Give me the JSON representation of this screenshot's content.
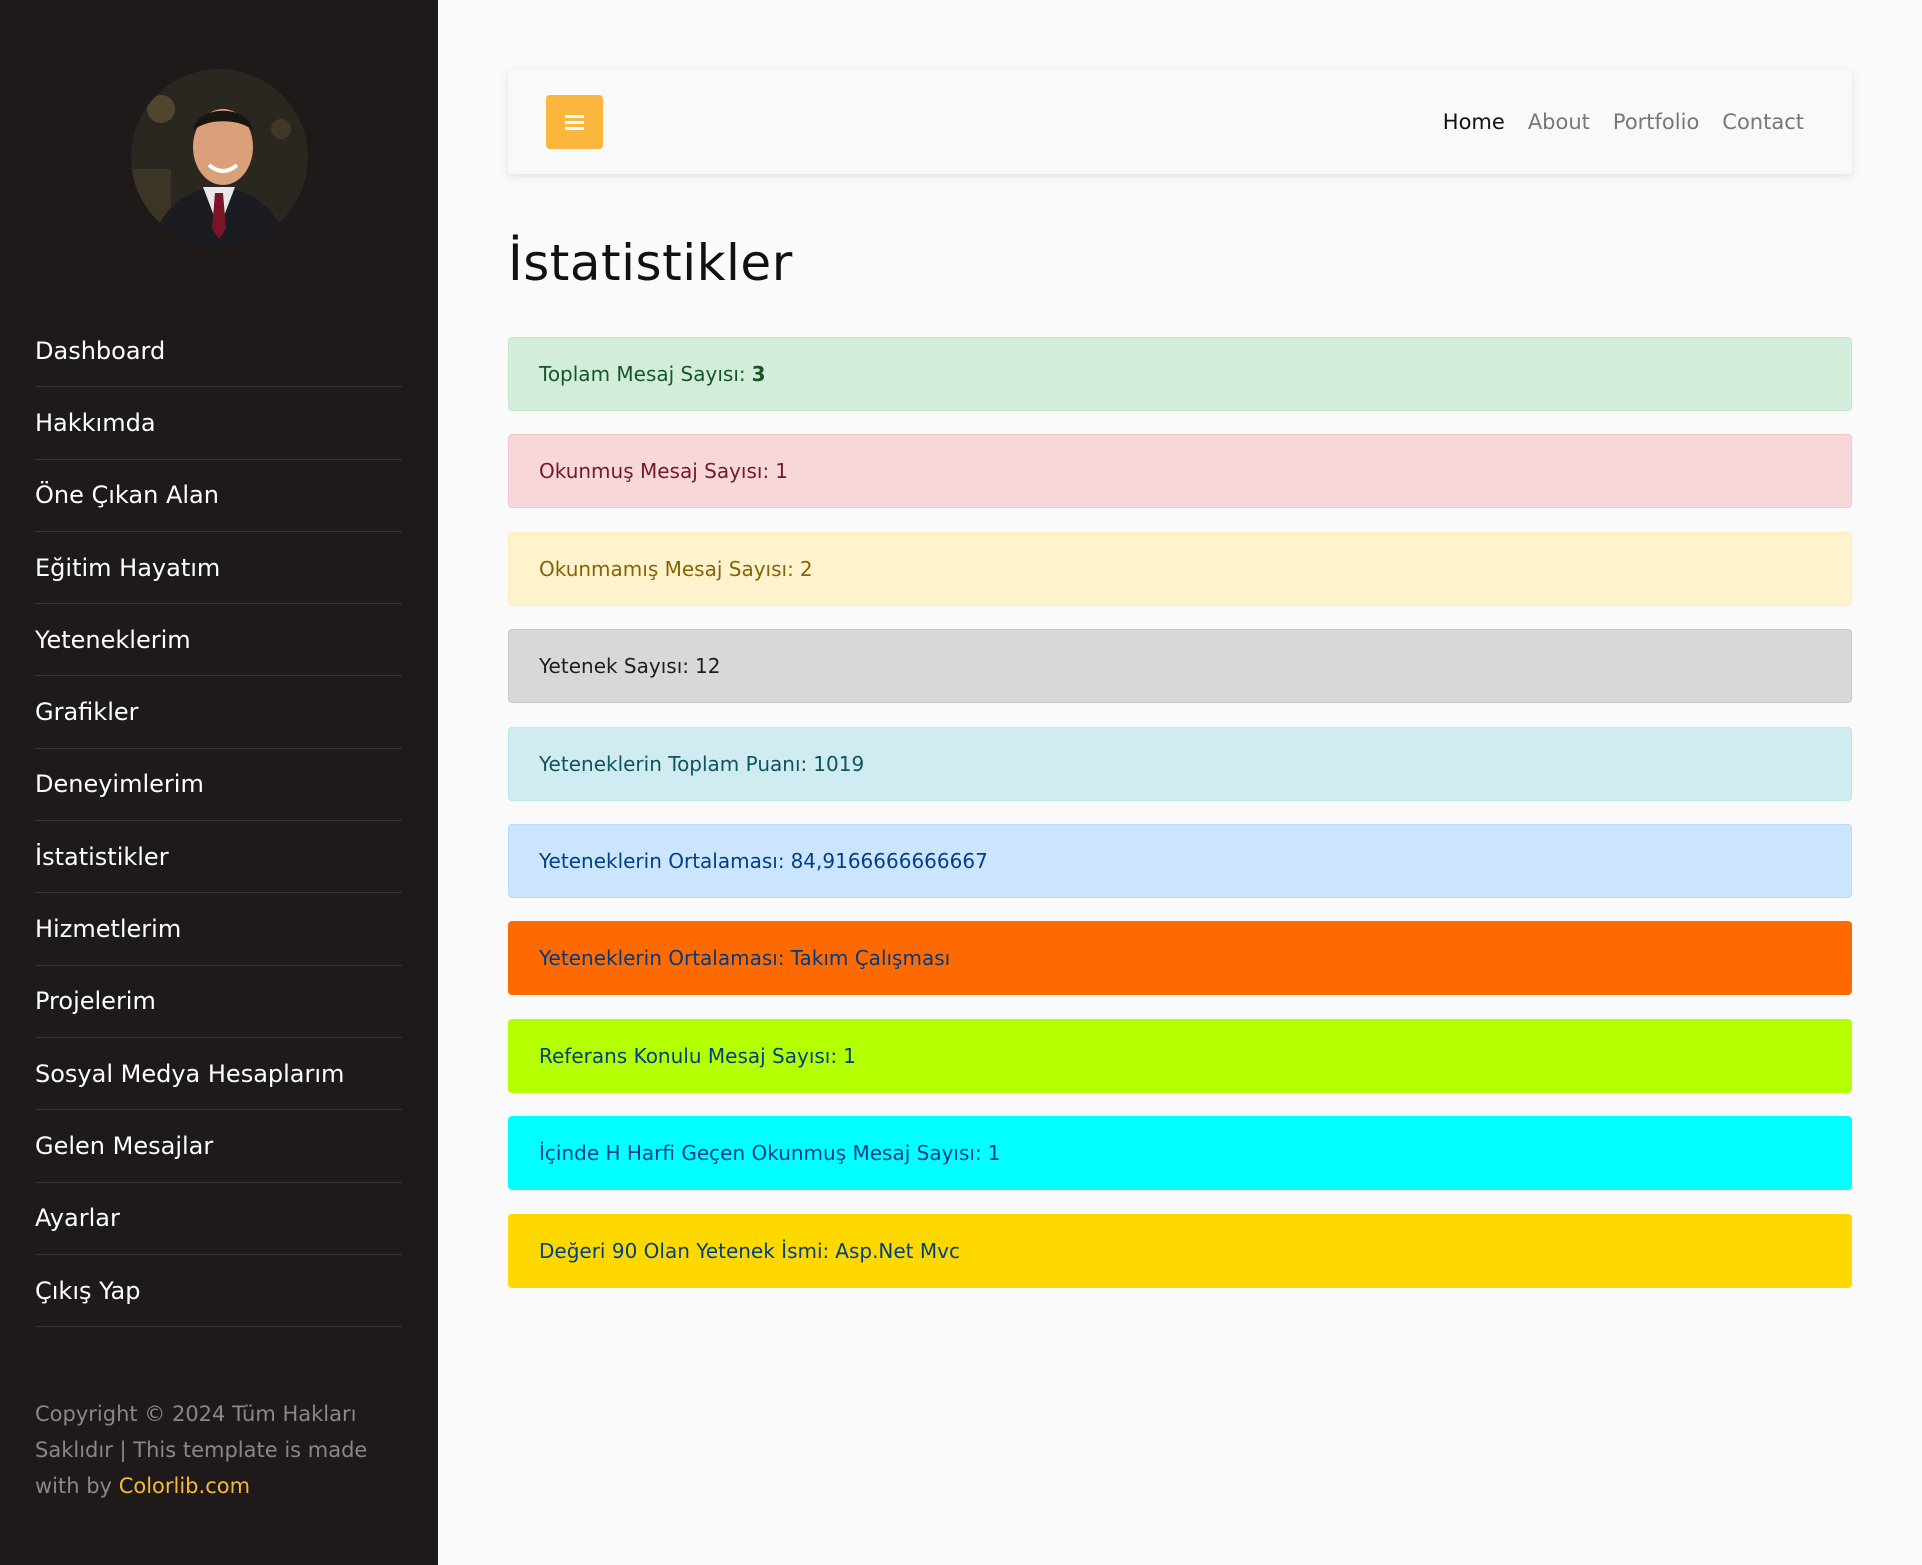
{
  "sidebar": {
    "avatar_icon": "profile-photo",
    "items": [
      {
        "label": "Dashboard"
      },
      {
        "label": "Hakkımda"
      },
      {
        "label": "Öne Çıkan Alan"
      },
      {
        "label": "Eğitim Hayatım"
      },
      {
        "label": "Yeteneklerim"
      },
      {
        "label": "Grafikler"
      },
      {
        "label": "Deneyimlerim"
      },
      {
        "label": "İstatistikler"
      },
      {
        "label": "Hizmetlerim"
      },
      {
        "label": "Projelerim"
      },
      {
        "label": "Sosyal Medya Hesaplarım"
      },
      {
        "label": "Gelen Mesajlar"
      },
      {
        "label": "Ayarlar"
      },
      {
        "label": "Çıkış Yap"
      }
    ],
    "footer": {
      "text": "Copyright © 2024 Tüm Hakları Saklıdır | This template is made with by",
      "brand": "Colorlib.com"
    }
  },
  "topbar": {
    "menu_icon": "hamburger-icon",
    "links": [
      {
        "label": "Home",
        "active": true
      },
      {
        "label": "About",
        "active": false
      },
      {
        "label": "Portfolio",
        "active": false
      },
      {
        "label": "Contact",
        "active": false
      }
    ]
  },
  "main": {
    "title": "İstatistikler",
    "stats": [
      {
        "label": "Toplam Mesaj Sayısı:",
        "value": "3",
        "bold": true,
        "bg": "#d4edda",
        "border": "#c3e6cb",
        "color": "#155724"
      },
      {
        "label": "Okunmuş Mesaj Sayısı:",
        "value": "1",
        "bold": false,
        "bg": "#f8d7da",
        "border": "#f5c6cb",
        "color": "#721c24"
      },
      {
        "label": "Okunmamış Mesaj Sayısı:",
        "value": "2",
        "bold": false,
        "bg": "#fff3cd",
        "border": "#ffeeba",
        "color": "#856404"
      },
      {
        "label": "Yetenek Sayısı:",
        "value": "12",
        "bold": false,
        "bg": "#d6d8d9",
        "border": "#c6c8ca",
        "color": "#1b1e21"
      },
      {
        "label": "Yeteneklerin Toplam Puanı:",
        "value": "1019",
        "bold": false,
        "bg": "#d1ecf1",
        "border": "#bee5eb",
        "color": "#0c5460"
      },
      {
        "label": "Yeteneklerin Ortalaması:",
        "value": "84,9166666666667",
        "bold": false,
        "bg": "#cce5ff",
        "border": "#b8daff",
        "color": "#004085"
      },
      {
        "label": "Yeteneklerin Ortalaması:",
        "value": "Takım Çalışması",
        "bold": false,
        "bg": "#ff6a00",
        "border": "#ff6a00",
        "color": "#003a80"
      },
      {
        "label": "Referans Konulu Mesaj Sayısı:",
        "value": "1",
        "bold": false,
        "bg": "#b4ff00",
        "border": "#b4ff00",
        "color": "#004085"
      },
      {
        "label": "İçinde H Harfi Geçen Okunmuş Mesaj Sayısı:",
        "value": "1",
        "bold": false,
        "bg": "#00ffff",
        "border": "#00ffff",
        "color": "#004085"
      },
      {
        "label": "Değeri 90 Olan Yetenek İsmi:",
        "value": "Asp.Net Mvc",
        "bold": false,
        "bg": "#ffd800",
        "border": "#ffd800",
        "color": "#004085"
      }
    ]
  }
}
